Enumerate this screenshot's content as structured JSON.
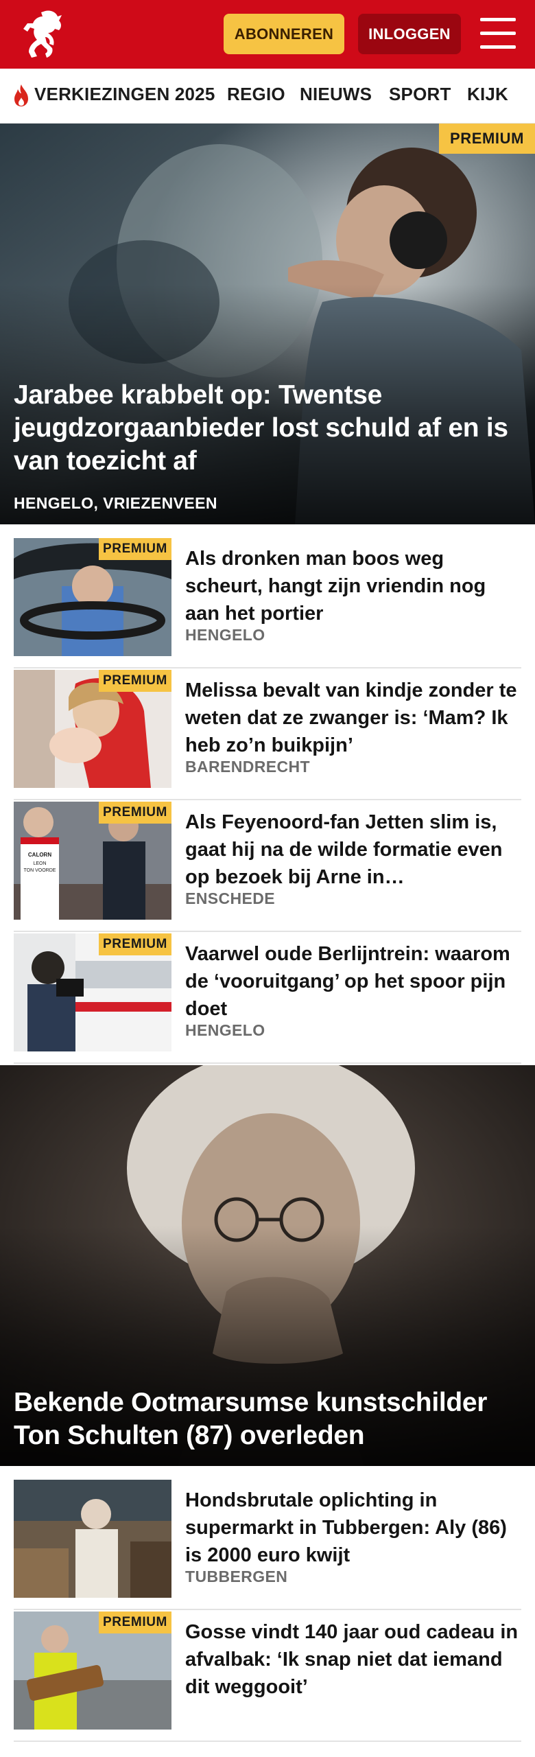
{
  "header": {
    "subscribe_label": "ABONNEREN",
    "login_label": "INLOGGEN",
    "colors": {
      "brand_red": "#cf0a18",
      "subscribe_yellow": "#f6c343",
      "login_dark_red": "#9b0610"
    }
  },
  "nav": {
    "items": [
      "VERKIEZINGEN 2025",
      "REGIO",
      "NIEUWS",
      "SPORT",
      "KIJK"
    ],
    "highlight_icon": "flame-icon"
  },
  "hero1": {
    "badge": "PREMIUM",
    "title": "Jarabee krabbelt op: Twentse jeugdzorgaanbieder lost schuld af en is van toezicht af",
    "location": "HENGELO, VRIEZENVEEN"
  },
  "articles1": [
    {
      "badge": "PREMIUM",
      "title": "Als dronken man boos weg scheurt, hangt zijn vriendin nog aan het portier",
      "location": "HENGELO"
    },
    {
      "badge": "PREMIUM",
      "title": "Melissa bevalt van kindje zonder te weten dat ze zwanger is: ‘Mam? Ik heb zo’n buikpijn’",
      "location": "BARENDRECHT"
    },
    {
      "badge": "PREMIUM",
      "title": "Als Feyenoord-fan Jetten slim is, gaat hij na de wilde formatie even op bezoek bij Arne in…",
      "location": "ENSCHEDE"
    },
    {
      "badge": "PREMIUM",
      "title": "Vaarwel oude Berlijntrein: waarom de ‘vooruitgang’ op het spoor pijn doet",
      "location": "HENGELO"
    }
  ],
  "hero2": {
    "title": "Bekende Ootmarsumse kunstschilder Ton Schulten (87) overleden"
  },
  "articles2": [
    {
      "badge": "",
      "title": "Hondsbrutale oplichting in supermarkt in Tubbergen: Aly (86) is 2000 euro kwijt",
      "location": "TUBBERGEN"
    },
    {
      "badge": "PREMIUM",
      "title": "Gosse vindt 140 jaar oud cadeau in afvalbak: ‘Ik snap niet dat iemand dit weggooit’",
      "location": ""
    }
  ],
  "images": {
    "thumb_caption_text": "CALORN LEON TON VOORDE"
  }
}
